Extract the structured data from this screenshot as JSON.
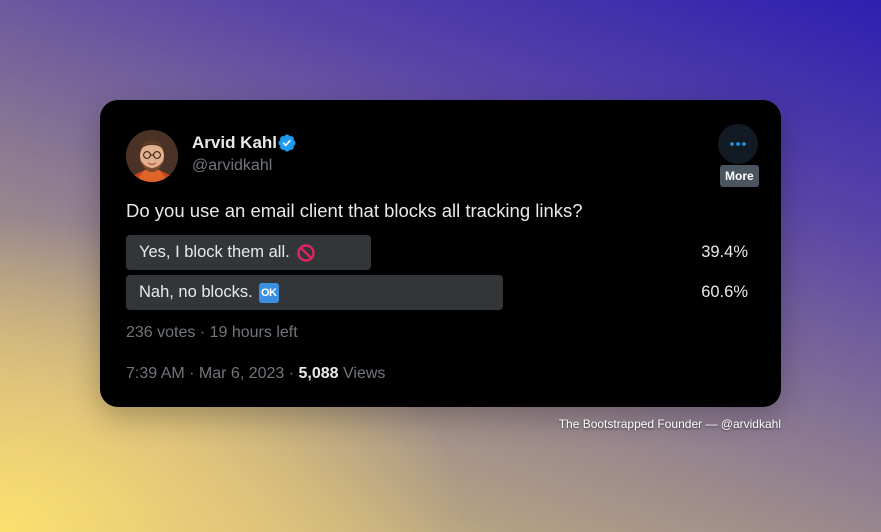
{
  "tweet": {
    "author_name": "Arvid Kahl",
    "handle": "@arvidkahl",
    "verified": true,
    "more_tooltip": "More",
    "question": "Do you use an email client that blocks all tracking links?",
    "poll": {
      "options": [
        {
          "label": "Yes, I block them all.",
          "emoji": "no-entry-emoji",
          "percent": "39.4%",
          "fraction": 0.394
        },
        {
          "label": "Nah, no blocks.",
          "emoji": "ok-button-emoji",
          "emoji_text": "OK",
          "percent": "60.6%",
          "fraction": 0.606
        }
      ],
      "meta": "236 votes · 19 hours left"
    },
    "timestamp": "7:39 AM · Mar 6, 2023 · ",
    "views_count": "5,088",
    "views_label": " Views"
  },
  "credit": "The Bootstrapped Founder — @arvidkahl",
  "colors": {
    "card_bg": "#000000",
    "text_primary": "#e7e9ea",
    "text_secondary": "#71767b",
    "verified_blue": "#1d9bf0",
    "poll_bar": "#333639"
  }
}
